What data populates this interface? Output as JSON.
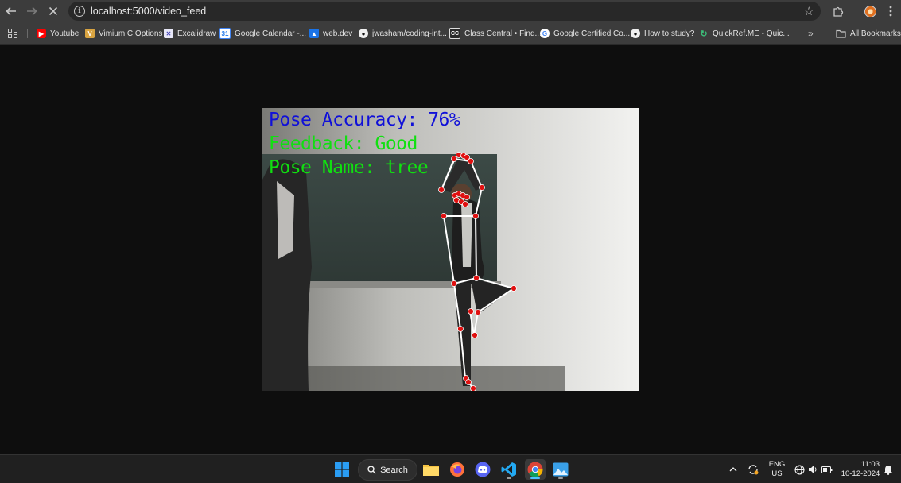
{
  "browser": {
    "url": "localhost:5000/video_feed",
    "bookmarks": [
      {
        "label": "Youtube",
        "icon": "youtube-icon"
      },
      {
        "label": "Vimium C Options",
        "icon": "vimium-icon"
      },
      {
        "label": "Excalidraw",
        "icon": "excalidraw-icon"
      },
      {
        "label": "Google Calendar -...",
        "icon": "google-calendar-icon"
      },
      {
        "label": "web.dev",
        "icon": "webdev-icon"
      },
      {
        "label": "jwasham/coding-int...",
        "icon": "github-icon"
      },
      {
        "label": "Class Central • Find...",
        "icon": "class-central-icon"
      },
      {
        "label": "Google Certified Co...",
        "icon": "google-icon"
      },
      {
        "label": "How to study?",
        "icon": "github-icon"
      },
      {
        "label": "QuickRef.ME - Quic...",
        "icon": "quickref-icon"
      }
    ],
    "all_bookmarks_label": "All Bookmarks"
  },
  "video_feed": {
    "accuracy_text": "Pose Accuracy: 76%",
    "feedback_text": "Feedback: Good",
    "pose_name_text": "Pose Name: tree",
    "colors": {
      "accuracy": "#1010d8",
      "feedback": "#10e010",
      "pose_name": "#10e010",
      "skeleton_line": "#ffffff",
      "keypoint": "#e01010"
    }
  },
  "taskbar": {
    "search_label": "Search",
    "language_line1": "ENG",
    "language_line2": "US",
    "time": "11:03",
    "date": "10-12-2024"
  }
}
